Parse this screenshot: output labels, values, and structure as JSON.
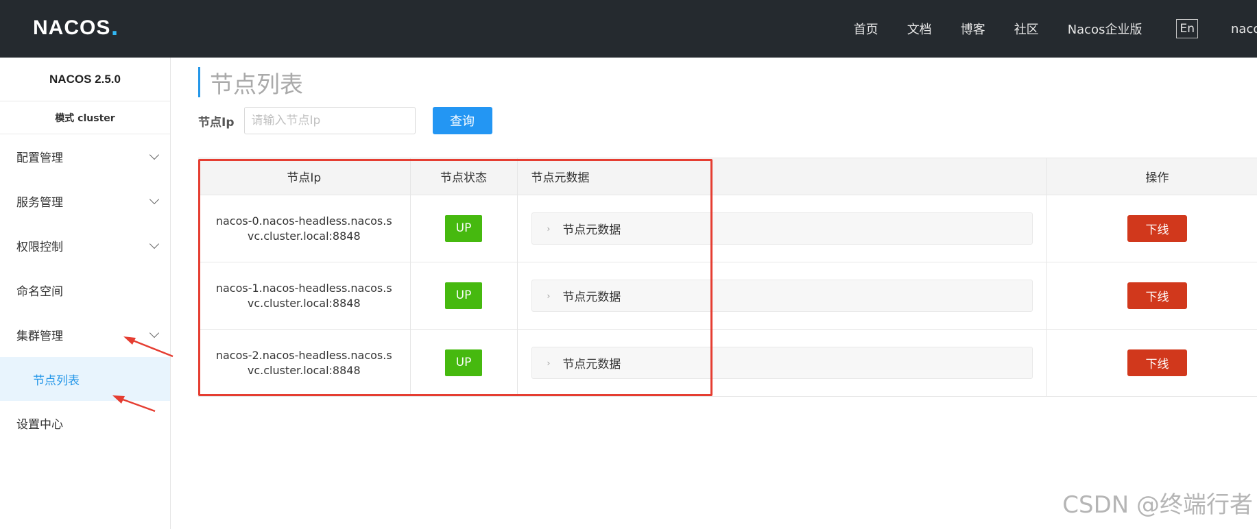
{
  "header": {
    "logo_text": "NAC",
    "logo_text_2": "OS",
    "logo_dot": ".",
    "nav": [
      "首页",
      "文档",
      "博客",
      "社区",
      "Nacos企业版"
    ],
    "lang": "En",
    "user": "nacos"
  },
  "sidebar": {
    "version": "NACOS 2.5.0",
    "mode": "模式  cluster",
    "items": [
      {
        "label": "配置管理"
      },
      {
        "label": "服务管理"
      },
      {
        "label": "权限控制"
      },
      {
        "label": "命名空间"
      },
      {
        "label": "集群管理"
      },
      {
        "label": "节点列表"
      },
      {
        "label": "设置中心"
      }
    ]
  },
  "main": {
    "title": "节点列表",
    "filter_label": "节点Ip",
    "filter_placeholder": "请输入节点Ip",
    "query_label": "查询",
    "columns": [
      "节点Ip",
      "节点状态",
      "节点元数据",
      "操作"
    ],
    "rows": [
      {
        "ip": "nacos-0.nacos-headless.nacos.svc.cluster.local:8848",
        "status": "UP",
        "meta": "节点元数据",
        "action": "下线"
      },
      {
        "ip": "nacos-1.nacos-headless.nacos.svc.cluster.local:8848",
        "status": "UP",
        "meta": "节点元数据",
        "action": "下线"
      },
      {
        "ip": "nacos-2.nacos-headless.nacos.svc.cluster.local:8848",
        "status": "UP",
        "meta": "节点元数据",
        "action": "下线"
      }
    ]
  },
  "watermark": "CSDN @终端行者",
  "colors": {
    "topbar": "#252a2f",
    "primary": "#2396f3",
    "up": "#46b90f",
    "danger": "#d1381c",
    "annotation": "#e53d31"
  }
}
